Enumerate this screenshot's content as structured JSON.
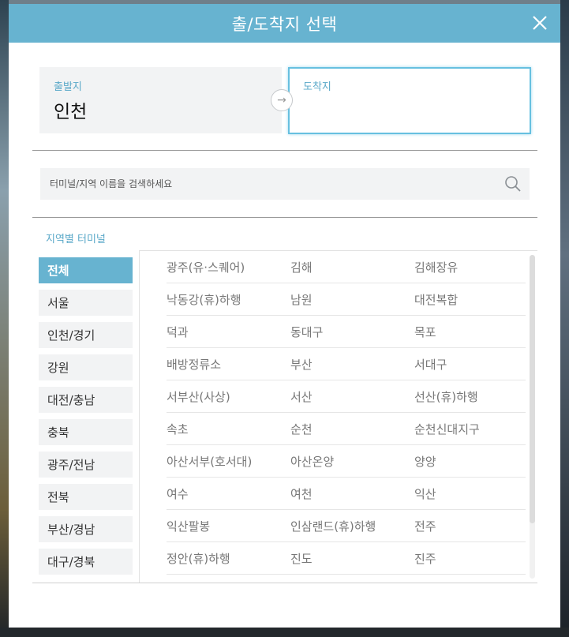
{
  "modal": {
    "title": "출/도착지 선택",
    "close_label": "×"
  },
  "route": {
    "departure_label": "출발지",
    "departure_value": "인천",
    "swap_icon": "→",
    "arrival_label": "도착지",
    "arrival_value": ""
  },
  "search": {
    "placeholder": "터미널/지역 이름을 검색하세요",
    "value": ""
  },
  "section_label": "지역별 터미널",
  "regions": [
    {
      "label": "전체",
      "active": true
    },
    {
      "label": "서울",
      "active": false
    },
    {
      "label": "인천/경기",
      "active": false
    },
    {
      "label": "강원",
      "active": false
    },
    {
      "label": "대전/충남",
      "active": false
    },
    {
      "label": "충북",
      "active": false
    },
    {
      "label": "광주/전남",
      "active": false
    },
    {
      "label": "전북",
      "active": false
    },
    {
      "label": "부산/경남",
      "active": false
    },
    {
      "label": "대구/경북",
      "active": false
    }
  ],
  "terminals": [
    [
      "광주(유·스퀘어)",
      "김해",
      "김해장유"
    ],
    [
      "낙동강(휴)하행",
      "남원",
      "대전복합"
    ],
    [
      "덕과",
      "동대구",
      "목포"
    ],
    [
      "배방정류소",
      "부산",
      "서대구"
    ],
    [
      "서부산(사상)",
      "서산",
      "선산(휴)하행"
    ],
    [
      "속초",
      "순천",
      "순천신대지구"
    ],
    [
      "아산서부(호서대)",
      "아산온양",
      "양양"
    ],
    [
      "여수",
      "여천",
      "익산"
    ],
    [
      "익산팔봉",
      "인삼랜드(휴)하행",
      "전주"
    ],
    [
      "정안(휴)하행",
      "진도",
      "진주"
    ]
  ],
  "colors": {
    "accent": "#67b3d0",
    "label": "#5aa8c8"
  }
}
